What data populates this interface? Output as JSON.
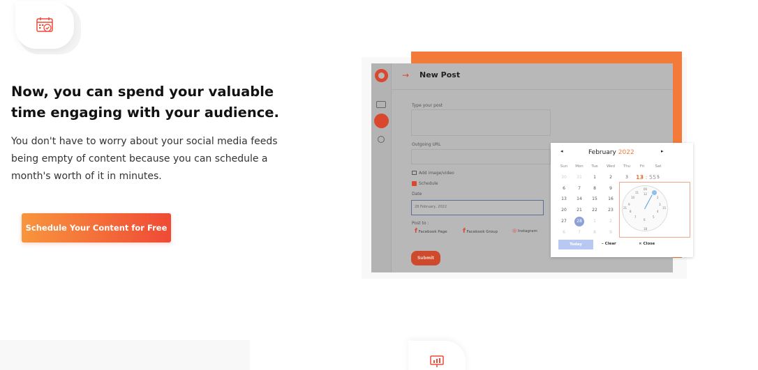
{
  "hero": {
    "headline": "Now, you can spend your valuable time engaging with your audience.",
    "body": "You don't have to worry about your social media feeds being empty of content because you can schedule a month's worth of it in minutes.",
    "cta_label": "Schedule Your Content for Free"
  },
  "icons": {
    "top_feature": "calendar-check-icon",
    "bottom_feature": "presentation-chart-icon"
  },
  "mockup": {
    "title": "New Post",
    "fields": {
      "post_label": "Type your post",
      "url_label": "Outgoing URL",
      "media_label": "Add image/video",
      "schedule_label": "Schedule",
      "date_label": "Date",
      "date_value": "28 February, 2022",
      "post_to_label": "Post to :"
    },
    "post_targets": [
      "Facebook Page",
      "Facebook Group",
      "Instagram"
    ],
    "submit_label": "Submit",
    "calendar": {
      "prev": "◂",
      "next": "▸",
      "month": "February",
      "year": "2022",
      "weekdays": [
        "Sun",
        "Mon",
        "Tue",
        "Wed",
        "Thu",
        "Fri",
        "Sat"
      ],
      "time_hours": "13",
      "time_sep": " : ",
      "time_minutes": "55",
      "today_label": "Today",
      "clear_label": "– Clear",
      "close_label": "× Close"
    }
  },
  "colors": {
    "accent": "#f47a3a",
    "cta_start": "#f8953d",
    "cta_end": "#ef4a36",
    "brand_red": "#d9482e"
  }
}
